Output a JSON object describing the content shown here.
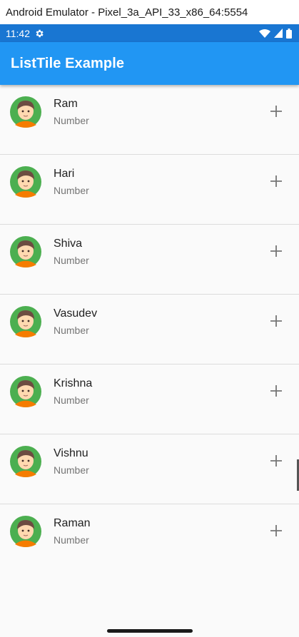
{
  "window": {
    "title": "Android Emulator - Pixel_3a_API_33_x86_64:5554"
  },
  "status_bar": {
    "time": "11:42"
  },
  "app_bar": {
    "title": "ListTile Example"
  },
  "colors": {
    "app_bar": "#2196f3",
    "status_bar": "#1976d2",
    "avatar_ring": "#4caf50"
  },
  "contacts": [
    {
      "name": "Ram",
      "subtitle": "Number"
    },
    {
      "name": "Hari",
      "subtitle": "Number"
    },
    {
      "name": "Shiva",
      "subtitle": "Number"
    },
    {
      "name": "Vasudev",
      "subtitle": "Number"
    },
    {
      "name": "Krishna",
      "subtitle": "Number"
    },
    {
      "name": "Vishnu",
      "subtitle": "Number"
    },
    {
      "name": "Raman",
      "subtitle": "Number"
    }
  ]
}
